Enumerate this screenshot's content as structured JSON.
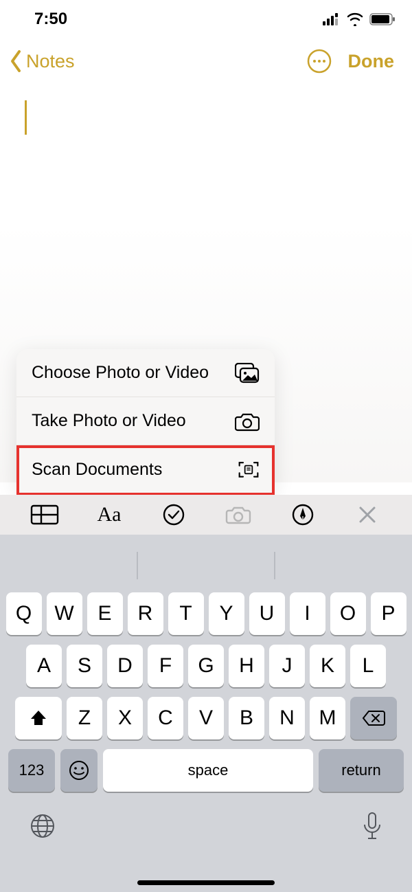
{
  "status": {
    "time": "7:50"
  },
  "nav": {
    "back_label": "Notes",
    "done_label": "Done"
  },
  "popup": {
    "items": [
      {
        "label": "Choose Photo or Video",
        "icon": "photo-stack"
      },
      {
        "label": "Take Photo or Video",
        "icon": "camera"
      },
      {
        "label": "Scan Documents",
        "icon": "doc-scan"
      }
    ],
    "highlighted_index": 2
  },
  "toolbar": {
    "items": [
      "table",
      "text-format",
      "checklist",
      "camera",
      "markup",
      "close"
    ]
  },
  "keyboard": {
    "rows": [
      [
        "Q",
        "W",
        "E",
        "R",
        "T",
        "Y",
        "U",
        "I",
        "O",
        "P"
      ],
      [
        "A",
        "S",
        "D",
        "F",
        "G",
        "H",
        "J",
        "K",
        "L"
      ],
      [
        "Z",
        "X",
        "C",
        "V",
        "B",
        "N",
        "M"
      ]
    ],
    "numbers_label": "123",
    "space_label": "space",
    "return_label": "return"
  }
}
